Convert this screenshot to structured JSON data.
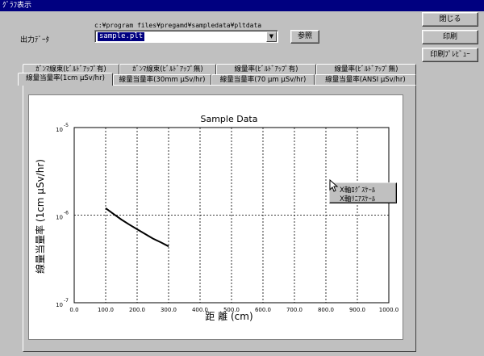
{
  "window": {
    "title": "ｸﾞﾗﾌ表示"
  },
  "output": {
    "path": "c:¥program files¥pregamd¥sampledata¥pltdata",
    "label": "出力ﾃﾞｰﾀ",
    "selected_file": "sample.plt",
    "browse_label": "参照"
  },
  "buttons": {
    "close": "閉じる",
    "print": "印刷",
    "preview": "印刷ﾌﾟﾚﾋﾞｭｰ"
  },
  "tabs": {
    "row1": [
      "ｶﾞﾝﾏ線束(ﾋﾞﾙﾄﾞｱｯﾌﾟ有)",
      "ｶﾞﾝﾏ線束(ﾋﾞﾙﾄﾞｱｯﾌﾟ無)",
      "線量率(ﾋﾞﾙﾄﾞｱｯﾌﾟ有)",
      "線量率(ﾋﾞﾙﾄﾞｱｯﾌﾟ無)"
    ],
    "row2": [
      "線量当量率(1cm μSv/hr)",
      "線量当量率(30mm μSv/hr)",
      "線量当量率(70 μm μSv/hr)",
      "線量当量率(ANSI μSv/hr)"
    ]
  },
  "context_menu": {
    "items": [
      "X軸ﾛｸﾞｽｹｰﾙ",
      "X軸ﾘﾆｱｽｹｰﾙ"
    ]
  },
  "chart_data": {
    "type": "line",
    "title": "Sample Data",
    "xlabel": "距 離 (cm)",
    "ylabel": "線量当量率 (1cm μSv/hr)",
    "xlim": [
      0,
      1000
    ],
    "ylim": [
      1e-07,
      1e-05
    ],
    "yscale": "log",
    "grid": true,
    "x_ticks": [
      "0.0",
      "100.0",
      "200.0",
      "300.0",
      "400.0",
      "500.0",
      "600.0",
      "700.0",
      "800.0",
      "900.0",
      "1000.0"
    ],
    "y_ticks": [
      {
        "base": "10",
        "exp": "-5"
      },
      {
        "base": "10",
        "exp": "-6"
      },
      {
        "base": "10",
        "exp": "-7"
      }
    ],
    "series": [
      {
        "x": [
          100,
          125,
          150,
          175,
          200,
          225,
          250,
          275,
          300
        ],
        "y": [
          1.2e-06,
          1.03e-06,
          8.9e-07,
          7.8e-07,
          6.9e-07,
          6.1e-07,
          5.4e-07,
          4.9e-07,
          4.4e-07
        ]
      }
    ],
    "colors": {
      "line": "#000000",
      "grid": "#000000"
    }
  }
}
